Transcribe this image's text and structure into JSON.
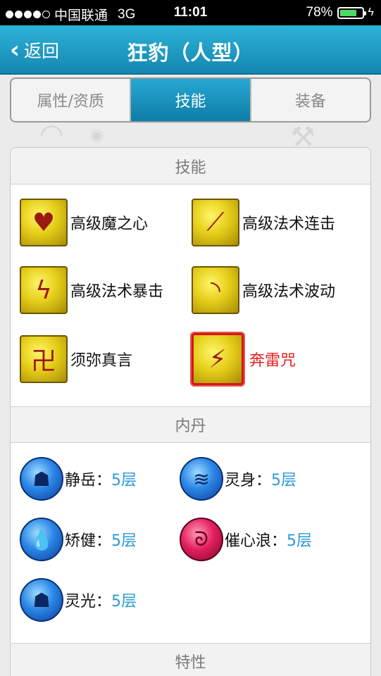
{
  "status": {
    "carrier": "中国联通",
    "network": "3G",
    "time": "11:01",
    "battery": "78%",
    "battery_level": 0.78
  },
  "header": {
    "back_label": "返回",
    "title": "狂豹（人型）"
  },
  "tabs": [
    {
      "label": "属性/资质",
      "active": false
    },
    {
      "label": "技能",
      "active": true
    },
    {
      "label": "装备",
      "active": false
    }
  ],
  "sections": {
    "skills_title": "技能",
    "neidan_title": "内丹",
    "traits_title": "特性"
  },
  "skills": [
    {
      "name": "高级魔之心",
      "icon": "heart-icon"
    },
    {
      "name": "高级法术连击",
      "icon": "slash-icon"
    },
    {
      "name": "高级法术暴击",
      "icon": "crack-icon"
    },
    {
      "name": "高级法术波动",
      "icon": "wave-icon"
    },
    {
      "name": "须弥真言",
      "icon": "rune-icon"
    },
    {
      "name": "奔雷咒",
      "icon": "lightning-icon",
      "highlight_color": "#e71e1e"
    }
  ],
  "neidan": [
    {
      "name": "静岳：",
      "level": "5层",
      "icon": "mountain-figure-icon"
    },
    {
      "name": "灵身：",
      "level": "5层",
      "icon": "spirit-body-icon"
    },
    {
      "name": "矫健：",
      "level": "5层",
      "icon": "droplet-icon"
    },
    {
      "name": "催心浪：",
      "level": "5层",
      "icon": "red-swirl-icon"
    },
    {
      "name": "灵光：",
      "level": "5层",
      "icon": "glow-figure-icon"
    }
  ],
  "colors": {
    "header_blue": "#1a9bc8",
    "level_blue": "#2d9ad3",
    "highlight_red": "#e71e1e"
  }
}
